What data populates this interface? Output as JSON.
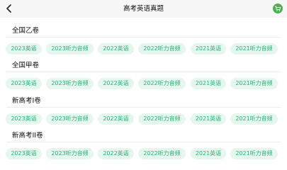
{
  "header": {
    "title": "高考英语真题"
  },
  "colors": {
    "accent": "#22b573",
    "chip_bg": "#e6f7ef",
    "cart": "#4caf50"
  },
  "sections": [
    {
      "title": "全国乙卷",
      "chips": [
        "2023英语",
        "2023听力音频",
        "2022英语",
        "2022听力音频",
        "2021英语",
        "2021听力音频"
      ]
    },
    {
      "title": "全国甲卷",
      "chips": [
        "2023英语",
        "2023听力音频",
        "2022英语",
        "2022听力音频",
        "2021英语",
        "2021听力音频"
      ]
    },
    {
      "title": "新高考I卷",
      "chips": [
        "2023英语",
        "2023听力音频",
        "2022英语",
        "2022听力音频",
        "2021英语",
        "2021听力音频"
      ]
    },
    {
      "title": "新高考II卷",
      "chips": [
        "2023英语",
        "2023听力音频",
        "2022英语",
        "2022听力音频",
        "2021英语",
        "2021听力音频"
      ]
    }
  ],
  "icons": {
    "back": "chevron-left-icon",
    "cart": "cart-icon"
  }
}
